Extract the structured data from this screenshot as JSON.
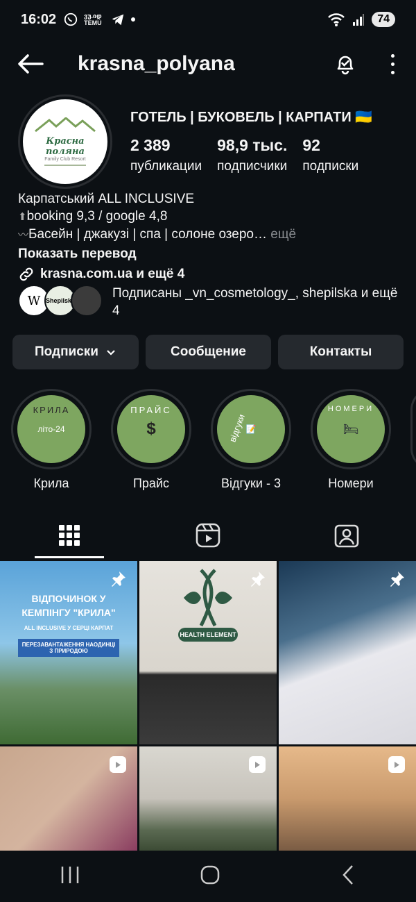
{
  "status_bar": {
    "time": "16:02",
    "app_badge": "ვუ.იდ TEMU",
    "battery": "74"
  },
  "header": {
    "username": "krasna_polyana"
  },
  "profile": {
    "avatar_title": "Красна поляна",
    "avatar_subtitle": "Family Club Resort",
    "full_name": "ГОТЕЛЬ | БУКОВЕЛЬ | КАРПАТИ 🇺🇦",
    "stats": [
      {
        "num": "2 389",
        "label": "публикации"
      },
      {
        "num": "98,9 тыс.",
        "label": "подписчики"
      },
      {
        "num": "92",
        "label": "подписки"
      }
    ]
  },
  "bio": {
    "line1": "Карпатський ALL INCLUSIVE",
    "line2_icon": "⬆",
    "line2": "booking 9,3 / google 4,8",
    "line3_icon": "〰",
    "line3": "Басейн | джакузі | спа | солоне озеро…",
    "more": " ещё",
    "translate": "Показать перевод",
    "link": "krasna.com.ua и ещё 4"
  },
  "followed_by": {
    "text": "Подписаны _vn_cosmetology_, shepilska и ещё 4",
    "avatar2_text": "Shepilska"
  },
  "buttons": {
    "following": "Подписки",
    "message": "Сообщение",
    "contacts": "Контакты"
  },
  "highlights": [
    {
      "label": "Крила",
      "inner_top": "КРИЛА",
      "inner_center": "літо-24"
    },
    {
      "label": "Прайс",
      "inner_top": "ПРАЙС",
      "inner_center": "$"
    },
    {
      "label": "Відгуки - 3",
      "inner_top": "відгуки",
      "inner_center": "📝"
    },
    {
      "label": "Номери",
      "inner_top": "НОМЕРИ",
      "inner_center": "🛏"
    }
  ],
  "posts": [
    {
      "title": "ВІДПОЧИНОК У КЕМПІНГУ \"КРИЛА\"",
      "sub": "ALL INCLUSIVE У СЕРЦІ КАРПАТ",
      "band": "ПЕРЕЗАВАНТАЖЕННЯ НАОДИНЦІ З ПРИРОДОЮ"
    },
    {
      "title": "HEALTH ELEMENT"
    }
  ],
  "icons": {
    "back": "arrow-left-icon",
    "bell": "bell-check-icon",
    "more": "more-vertical-icon",
    "grid": "grid-icon",
    "reels": "reels-icon",
    "tagged": "tagged-icon",
    "pin": "pin-icon"
  }
}
